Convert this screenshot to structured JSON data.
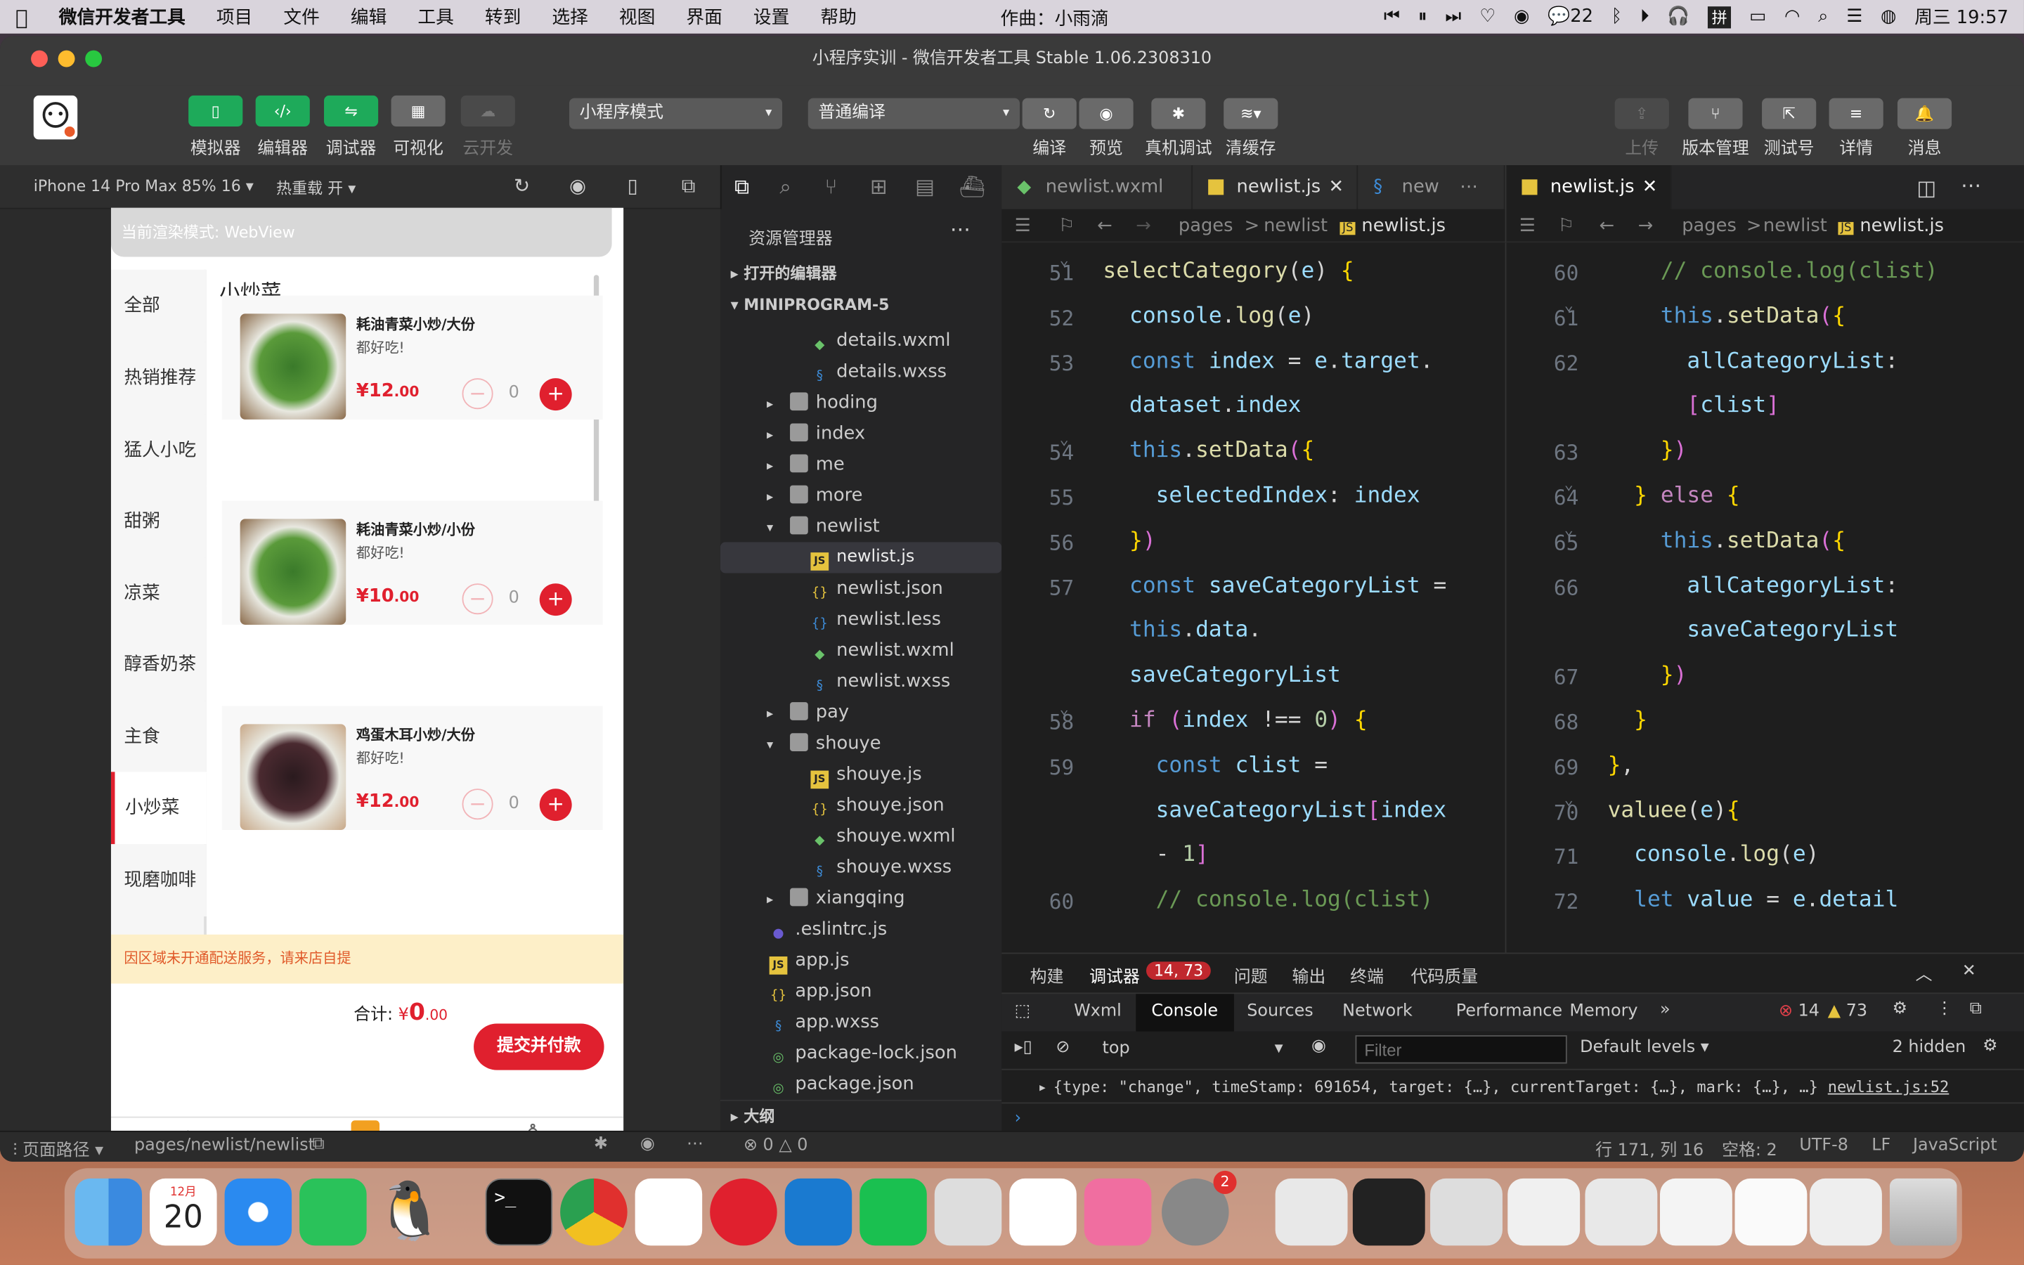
{
  "menubar": {
    "app": "微信开发者工具",
    "items": [
      "项目",
      "文件",
      "编辑",
      "工具",
      "转到",
      "选择",
      "视图",
      "界面",
      "设置",
      "帮助"
    ],
    "center": "作曲：小雨滴",
    "wechat_count": "22",
    "time": "周三 19:57"
  },
  "window": {
    "title": "小程序实训 - 微信开发者工具 Stable 1.06.2308310"
  },
  "toolbar": {
    "simulator": "模拟器",
    "editor": "编辑器",
    "debugger": "调试器",
    "visual": "可视化",
    "cloud": "云开发",
    "mode": "小程序模式",
    "compile_mode": "普通编译",
    "compile": "编译",
    "preview": "预览",
    "real_debug": "真机调试",
    "clear_cache": "清缓存",
    "upload": "上传",
    "version": "版本管理",
    "test_id": "测试号",
    "details": "详情",
    "messages": "消息"
  },
  "device": {
    "model": "iPhone 14 Pro Max 85% 16",
    "hot_reload": "热重载 开"
  },
  "simulator": {
    "render_mode": "当前渲染模式: WebView",
    "categories": [
      "全部",
      "热销推荐",
      "猛人小吃",
      "甜粥",
      "凉菜",
      "醇香奶茶",
      "主食",
      "小炒菜",
      "现磨咖啡"
    ],
    "active_category": "小炒菜",
    "section_title": "小炒菜",
    "dishes": [
      {
        "name": "耗油青菜小炒/大份",
        "desc": "都好吃!",
        "price": "¥12",
        "cents": ".00",
        "qty": "0"
      },
      {
        "name": "耗油青菜小炒/小份",
        "desc": "都好吃!",
        "price": "¥10",
        "cents": ".00",
        "qty": "0"
      },
      {
        "name": "鸡蛋木耳小炒/大份",
        "desc": "都好吃!",
        "price": "¥12",
        "cents": ".00",
        "qty": "0"
      }
    ],
    "notice": "因区域未开通配送服务，请来店自提",
    "total_label": "合计:",
    "total_currency": "¥",
    "total_int": "0",
    "total_dec": ".00",
    "checkout": "提交并付款"
  },
  "explorer": {
    "title": "资源管理器",
    "open_editors": "打开的编辑器",
    "project": "MINIPROGRAM-5",
    "outline": "大纲",
    "rows": [
      {
        "name": "details.wxml",
        "type": "wxml",
        "indent": 3
      },
      {
        "name": "details.wxss",
        "type": "wxss",
        "indent": 3
      },
      {
        "name": "hoding",
        "type": "folder",
        "indent": 2,
        "arrow": "▸"
      },
      {
        "name": "index",
        "type": "folder",
        "indent": 2,
        "arrow": "▸"
      },
      {
        "name": "me",
        "type": "folder",
        "indent": 2,
        "arrow": "▸"
      },
      {
        "name": "more",
        "type": "folder",
        "indent": 2,
        "arrow": "▸"
      },
      {
        "name": "newlist",
        "type": "folder",
        "indent": 2,
        "arrow": "▾"
      },
      {
        "name": "newlist.js",
        "type": "js",
        "indent": 3,
        "selected": true
      },
      {
        "name": "newlist.json",
        "type": "json",
        "indent": 3
      },
      {
        "name": "newlist.less",
        "type": "less",
        "indent": 3
      },
      {
        "name": "newlist.wxml",
        "type": "wxml",
        "indent": 3
      },
      {
        "name": "newlist.wxss",
        "type": "wxss",
        "indent": 3
      },
      {
        "name": "pay",
        "type": "folder",
        "indent": 2,
        "arrow": "▸"
      },
      {
        "name": "shouye",
        "type": "folder",
        "indent": 2,
        "arrow": "▾"
      },
      {
        "name": "shouye.js",
        "type": "js",
        "indent": 3
      },
      {
        "name": "shouye.json",
        "type": "json",
        "indent": 3
      },
      {
        "name": "shouye.wxml",
        "type": "wxml",
        "indent": 3
      },
      {
        "name": "shouye.wxss",
        "type": "wxss",
        "indent": 3
      },
      {
        "name": "xiangqing",
        "type": "folder",
        "indent": 2,
        "arrow": "▸"
      },
      {
        "name": ".eslintrc.js",
        "type": "eslint",
        "indent": 1
      },
      {
        "name": "app.js",
        "type": "js",
        "indent": 1
      },
      {
        "name": "app.json",
        "type": "json",
        "indent": 1
      },
      {
        "name": "app.wxss",
        "type": "wxss",
        "indent": 1
      },
      {
        "name": "package-lock.json",
        "type": "pkg",
        "indent": 1
      },
      {
        "name": "package.json",
        "type": "pkg",
        "indent": 1
      }
    ]
  },
  "editor_left": {
    "tabs": [
      "newlist.wxml",
      "newlist.js",
      "new"
    ],
    "active_tab": "newlist.js",
    "crumbs": [
      "pages",
      ">",
      "newlist",
      ">",
      "newlist.js",
      ">"
    ]
  },
  "editor_right": {
    "tabs": [
      "newlist.js"
    ],
    "crumbs": [
      "pages",
      ">",
      "newlist",
      ">",
      "newlist.js",
      ">"
    ]
  },
  "debugger": {
    "tabs": [
      "构建",
      "调试器",
      "问题",
      "输出",
      "终端",
      "代码质量"
    ],
    "badge": "14, 73",
    "devtabs": [
      "Wxml",
      "Console",
      "Sources",
      "Network",
      "Performance",
      "Memory"
    ],
    "errors": "14",
    "warnings": "73",
    "context": "top",
    "filter": "Filter",
    "levels": "Default levels",
    "hidden": "2 hidden",
    "log_line": "{type: \"change\", timeStamp: 691654, target: {…}, currentTarget: {…}, mark: {…}, …}",
    "log_src": "newlist.js:52"
  },
  "status": {
    "page_path_label": "页面路径",
    "page_path": "pages/newlist/newlist",
    "errors": "0",
    "warnings": "0",
    "position": "行 171, 列 16",
    "spaces": "空格: 2",
    "encoding": "UTF-8",
    "eol": "LF",
    "language": "JavaScript"
  },
  "dock": {
    "calendar_month": "12月",
    "calendar_day": "20",
    "badge": "2"
  }
}
